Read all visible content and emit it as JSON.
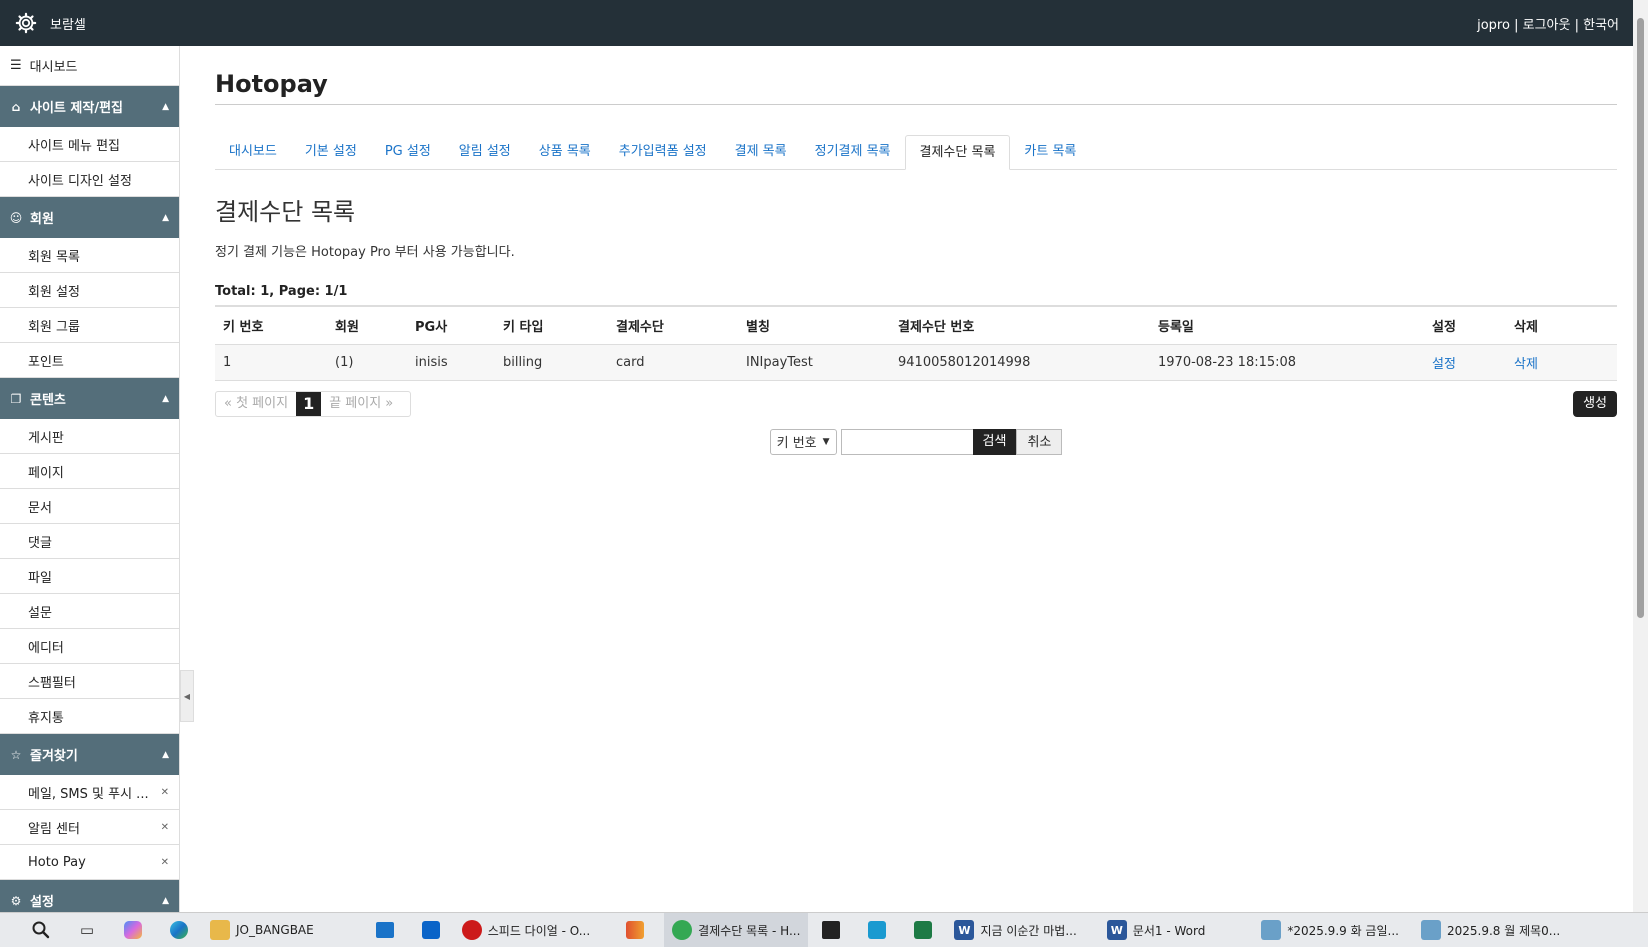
{
  "header": {
    "brand": "보람셀",
    "user": "jopro",
    "logout": "로그아웃",
    "language": "한국어"
  },
  "sidebar": {
    "dashboard": "대시보드",
    "sections": [
      {
        "title": "사이트 제작/편집",
        "icon": "home-icon",
        "items": [
          "사이트 메뉴 편집",
          "사이트 디자인 설정"
        ]
      },
      {
        "title": "회원",
        "icon": "users-icon",
        "items": [
          "회원 목록",
          "회원 설정",
          "회원 그룹",
          "포인트"
        ]
      },
      {
        "title": "콘텐츠",
        "icon": "copy-icon",
        "items": [
          "게시판",
          "페이지",
          "문서",
          "댓글",
          "파일",
          "설문",
          "에디터",
          "스팸필터",
          "휴지통"
        ]
      },
      {
        "title": "즐겨찾기",
        "icon": "star-icon",
        "items": [
          "메일, SMS 및 푸시 ...",
          "알림 센터",
          "Hoto Pay"
        ]
      },
      {
        "title": "설정",
        "icon": "gear-icon",
        "items": []
      }
    ]
  },
  "main": {
    "title": "Hotopay",
    "tabs": [
      "대시보드",
      "기본 설정",
      "PG 설정",
      "알림 설정",
      "상품 목록",
      "추가입력폼 설정",
      "결제 목록",
      "정기결제 목록",
      "결제수단 목록",
      "카트 목록"
    ],
    "active_tab": "결제수단 목록",
    "section_title": "결제수단 목록",
    "notice": "정기 결제 기능은 Hotopay Pro 부터 사용 가능합니다.",
    "total": "Total: 1, Page: 1/1",
    "table": {
      "headers": [
        "키 번호",
        "회원",
        "PG사",
        "키 타입",
        "결제수단",
        "별칭",
        "결제수단 번호",
        "등록일",
        "설정",
        "삭제"
      ],
      "rows": [
        [
          "1",
          "(1)",
          "inisis",
          "billing",
          "card",
          "INIpayTest",
          "9410058012014998",
          "1970-08-23 18:15:08",
          "설정",
          "삭제"
        ]
      ]
    },
    "pager": {
      "first": "« 첫 페이지",
      "current": "1",
      "last": "끝 페이지 »"
    },
    "create_button": "생성",
    "search": {
      "select_value": "키 번호",
      "input_value": "",
      "search_button": "검색",
      "cancel_button": "취소"
    }
  },
  "taskbar": {
    "apps": [
      {
        "label": "JO_BANGBAE",
        "icon": "folder-icon",
        "color": "#e8b84a"
      },
      {
        "label": "스피드 다이얼 - O...",
        "icon": "opera-icon",
        "color": "#cc1a1a"
      },
      {
        "label": "결제수단 목록 - H...",
        "icon": "chrome-icon",
        "color": "#34a853"
      },
      {
        "label": "지금 이순간 마법...",
        "icon": "word-icon",
        "color": "#2b579a"
      },
      {
        "label": "문서1 - Word",
        "icon": "word-icon",
        "color": "#2b579a"
      },
      {
        "label": "*2025.9.9 화 금일...",
        "icon": "notepad-icon",
        "color": "#6aa0c8"
      },
      {
        "label": "2025.9.8 월 제목0...",
        "icon": "notepad-icon",
        "color": "#6aa0c8"
      }
    ]
  },
  "colors": {
    "header_bg": "#243038",
    "section_bg": "#546e7a",
    "link": "#1a73c8"
  }
}
